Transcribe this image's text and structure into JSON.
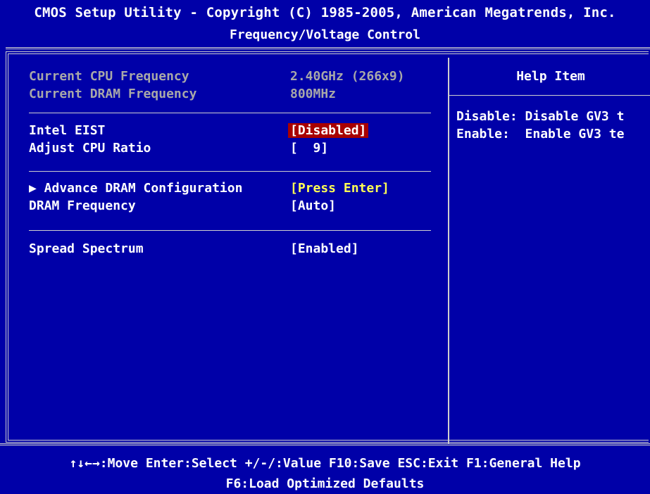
{
  "header": {
    "title": "CMOS Setup Utility - Copyright (C) 1985-2005, American Megatrends, Inc.",
    "subtitle": "Frequency/Voltage Control"
  },
  "settings": {
    "cpu_freq": {
      "label": "Current CPU Frequency",
      "value": "2.40GHz (266x9)"
    },
    "dram_freq_current": {
      "label": "Current DRAM Frequency",
      "value": "800MHz"
    },
    "intel_eist": {
      "label": "Intel EIST",
      "value": "[Disabled]"
    },
    "cpu_ratio": {
      "label": "Adjust CPU Ratio",
      "value": "[  9]"
    },
    "adv_dram": {
      "label": "▶ Advance DRAM Configuration",
      "value": "[Press Enter]"
    },
    "dram_freq": {
      "label": "DRAM Frequency",
      "value": "[Auto]"
    },
    "spread_spectrum": {
      "label": "Spread Spectrum",
      "value": "[Enabled]"
    }
  },
  "help": {
    "title": "Help Item",
    "line1": "Disable: Disable GV3 t",
    "line2": "Enable:  Enable GV3 te"
  },
  "footer": {
    "line1": "↑↓←→:Move  Enter:Select  +/-/:Value  F10:Save  ESC:Exit  F1:General Help",
    "line2": "F6:Load Optimized Defaults"
  },
  "colors": {
    "background": "#0000a8",
    "selected": "#a80000",
    "submenu": "#ffff54",
    "dim_text": "#a8a8a8"
  }
}
